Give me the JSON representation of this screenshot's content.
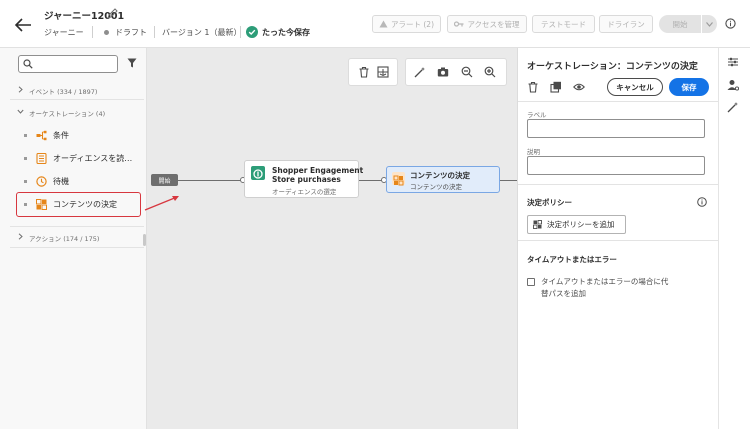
{
  "header": {
    "title": "ジャーニー12001",
    "breadcrumb_type": "ジャーニー",
    "status": "ドラフト",
    "version": "バージョン 1（最新）",
    "saved_status": "たった今保存",
    "buttons": {
      "alerts": "アラート (2)",
      "manage_access": "アクセスを管理",
      "test_mode": "テストモード",
      "dry_run": "ドライラン",
      "publish": "開始"
    }
  },
  "left_panel": {
    "search_placeholder": "",
    "events_section": "イベント (334 / 1897)",
    "orchestration_section": "オーケストレーション (4)",
    "items": [
      "条件",
      "オーディエンスを読…",
      "待機",
      "コンテンツの決定"
    ],
    "actions_section": "アクション (174 / 175)"
  },
  "canvas": {
    "start_label": "開始",
    "node1": {
      "title_line1": "Shopper Engagement",
      "title_line2": "Store purchases",
      "subtitle": "オーディエンスの選定"
    },
    "node2": {
      "title": "コンテンツの決定",
      "subtitle": "コンテンツの決定"
    }
  },
  "right_panel": {
    "title": "オーケストレーション：コンテンツの決定",
    "cancel": "キャンセル",
    "save": "保存",
    "label_field": "ラベル",
    "description_field": "説明",
    "decision_policy_heading": "決定ポリシー",
    "add_decision_policy": "決定ポリシーを追加",
    "timeout_heading": "タイムアウトまたはエラー",
    "timeout_checkbox": "タイムアウトまたはエラーの場合に代替パスを追加"
  },
  "colors": {
    "accent": "#1473e6",
    "highlight": "#d7373f",
    "condition_icon": "#e68619",
    "audience_icon": "#2d9d78"
  }
}
